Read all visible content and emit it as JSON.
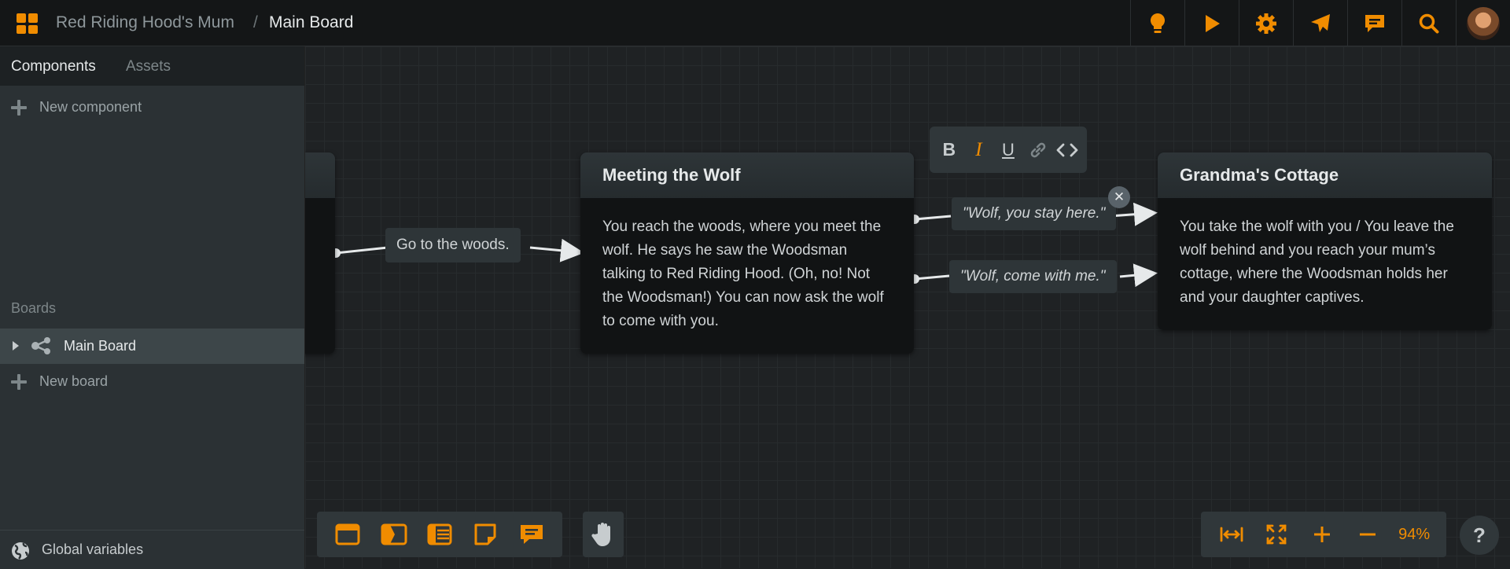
{
  "colors": {
    "accent": "#f08c00",
    "canvas": "#1f2224",
    "sidebar": "#2b3134",
    "topbar": "#141617"
  },
  "header": {
    "project": "Red Riding Hood's Mum",
    "separator": "/",
    "board": "Main Board",
    "actions": [
      "lightbulb-icon",
      "play-icon",
      "gear-icon",
      "send-icon",
      "comment-icon",
      "search-icon"
    ]
  },
  "sidebar": {
    "tabs": [
      "Components",
      "Assets"
    ],
    "new_component": "New component",
    "boards_label": "Boards",
    "boards": [
      {
        "label": "Main Board"
      }
    ],
    "new_board": "New board",
    "footer": "Global variables"
  },
  "canvas": {
    "nodes": [
      {
        "title": "Meeting the Wolf",
        "body": "You reach the woods, where you meet the wolf. He says he saw the Woodsman talking to Red Riding Hood. (Oh, no! Not the Woodsman!) You can now ask the wolf to come with you."
      },
      {
        "title": "Grandma's Cottage",
        "body": "You take the wolf with you / You leave the wolf behind and you reach your mum’s cottage, where the Woodsman holds her and your daughter captives."
      }
    ],
    "links": [
      {
        "label": "Go to the woods."
      },
      {
        "label": "\"Wolf, you stay here.\""
      },
      {
        "label": "\"Wolf, come with me.\""
      }
    ],
    "format_toolbar": [
      "bold-icon",
      "italic-icon",
      "underline-icon",
      "link-icon",
      "code-icon"
    ],
    "close_symbol": "✕",
    "bottom_tools": [
      "card-icon",
      "jump-icon",
      "list-icon",
      "note-icon",
      "comment-icon"
    ],
    "zoom": {
      "value": "94%"
    },
    "help": "?"
  }
}
